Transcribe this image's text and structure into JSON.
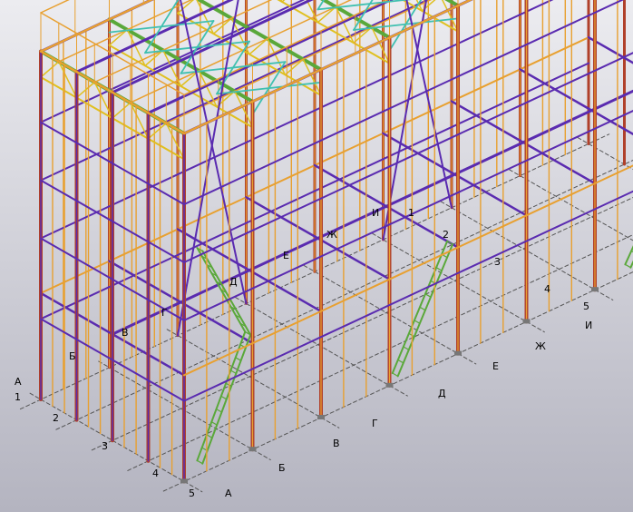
{
  "grid_labels_left": [
    {
      "text": "А"
    },
    {
      "text": "1"
    },
    {
      "text": "2"
    },
    {
      "text": "3"
    },
    {
      "text": "4"
    },
    {
      "text": "5"
    },
    {
      "text": "А"
    }
  ],
  "grid_labels_front": [
    {
      "text": "Б"
    },
    {
      "text": "В"
    },
    {
      "text": "Г"
    },
    {
      "text": "Д"
    },
    {
      "text": "Е"
    },
    {
      "text": "Ж"
    },
    {
      "text": "И"
    },
    {
      "text": "5"
    }
  ],
  "interior_labels": [
    {
      "text": "Б"
    },
    {
      "text": "В"
    },
    {
      "text": "Г"
    },
    {
      "text": "Д"
    },
    {
      "text": "Е"
    },
    {
      "text": "Ж"
    },
    {
      "text": "И"
    },
    {
      "text": "1"
    },
    {
      "text": "2"
    },
    {
      "text": "3"
    },
    {
      "text": "4"
    }
  ],
  "colors": {
    "background_top": "#e6e6ea",
    "background_bottom": "#b8b8c2",
    "column": "#b0402a",
    "post": "#e8a030",
    "beam_purple": "#5a2bb0",
    "beam_green": "#5aa83a",
    "truss_yellow": "#e0c020",
    "brace_cyan": "#40c0b0",
    "grid_line": "#555555"
  }
}
